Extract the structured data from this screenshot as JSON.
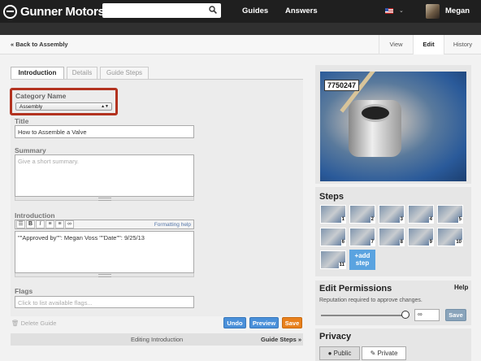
{
  "header": {
    "brand": "Gunner Motors",
    "search": {
      "placeholder": ""
    },
    "nav": [
      "Guides",
      "Answers"
    ],
    "user": "Megan"
  },
  "subnav": {
    "back": "« Back to Assembly",
    "tabs": [
      "View",
      "Edit",
      "History"
    ],
    "active": "Edit"
  },
  "tabs": [
    "Introduction",
    "Details",
    "Guide Steps"
  ],
  "form": {
    "category": {
      "label": "Category Name",
      "value": "Assembly"
    },
    "title": {
      "label": "Title",
      "value": "How to Assemble a Valve"
    },
    "summary": {
      "label": "Summary",
      "placeholder": "Give a short summary."
    },
    "introduction": {
      "label": "Introduction",
      "formatting": "Formatting help",
      "value": "\"\"Approved by\"\": Megan Voss  \"\"Date\"\": 9/25/13"
    },
    "flags": {
      "label": "Flags",
      "placeholder": "Click to list available flags..."
    },
    "toolbar": [
      "B",
      "I",
      "≡",
      "≡",
      "∞"
    ]
  },
  "buttons": {
    "undo": "Undo",
    "preview": "Preview",
    "save": "Save",
    "delete": "Delete Guide"
  },
  "footer": {
    "editing": "Editing Introduction",
    "next": "Guide Steps »"
  },
  "image": {
    "callout": "7750247"
  },
  "steps": {
    "title": "Steps",
    "numbers": [
      "1",
      "2",
      "3",
      "4",
      "5",
      "6",
      "7",
      "8",
      "9",
      "10",
      "11"
    ],
    "add": "+add step"
  },
  "permissions": {
    "title": "Edit Permissions",
    "help": "Help",
    "desc": "Reputation required to approve changes.",
    "value": "∞",
    "save": "Save",
    "slider_level": 1.0
  },
  "privacy": {
    "title": "Privacy",
    "public": "Public",
    "private": "Private"
  },
  "colors": {
    "accent": "#4a90d9",
    "save": "#e8801c",
    "highlight": "#b2321f"
  }
}
